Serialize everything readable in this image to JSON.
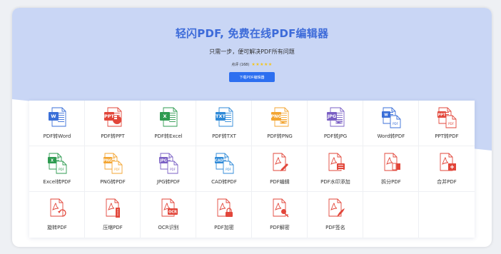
{
  "header": {
    "title": "轻闪PDF, 免费在线PDF编辑器",
    "subtitle": "只需一步，便可解决PDF所有问题",
    "rating_text": "点评 (168)",
    "stars": "★★★★★",
    "download_label": "下载PDF编辑器"
  },
  "colors": {
    "title": "#3d6bd9",
    "hero_background": "#c9d6f5",
    "button": "#2d6ff0",
    "stars": "#f5c518",
    "pdf_red": "#e2463a",
    "word_blue": "#3a6fd8",
    "excel_green": "#2e9b50",
    "png_orange": "#f3a532",
    "jpg_purple": "#7a5fc4",
    "txt_cad_blue": "#2f8ad8"
  },
  "tools": [
    {
      "label": "PDF转Word",
      "icon": "pdf-to-word-icon",
      "badge": "W"
    },
    {
      "label": "PDF转PPT",
      "icon": "pdf-to-ppt-icon",
      "badge": "PPT"
    },
    {
      "label": "PDF转Excel",
      "icon": "pdf-to-excel-icon",
      "badge": "X"
    },
    {
      "label": "PDF转TXT",
      "icon": "pdf-to-txt-icon",
      "badge": "TXT"
    },
    {
      "label": "PDF转PNG",
      "icon": "pdf-to-png-icon",
      "badge": "PNG"
    },
    {
      "label": "PDF转JPG",
      "icon": "pdf-to-jpg-icon",
      "badge": "JPG"
    },
    {
      "label": "Word转PDF",
      "icon": "word-to-pdf-icon",
      "badge": "W"
    },
    {
      "label": "PPT转PDF",
      "icon": "ppt-to-pdf-icon",
      "badge": "PPT"
    },
    {
      "label": "Excel转PDF",
      "icon": "excel-to-pdf-icon",
      "badge": "X"
    },
    {
      "label": "PNG转PDF",
      "icon": "png-to-pdf-icon",
      "badge": "PNG"
    },
    {
      "label": "JPG转PDF",
      "icon": "jpg-to-pdf-icon",
      "badge": "JPG"
    },
    {
      "label": "CAD转PDF",
      "icon": "cad-to-pdf-icon",
      "badge": "CAD"
    },
    {
      "label": "PDF编辑",
      "icon": "pdf-edit-icon"
    },
    {
      "label": "PDF水印添加",
      "icon": "pdf-watermark-icon"
    },
    {
      "label": "拆分PDF",
      "icon": "pdf-split-icon"
    },
    {
      "label": "合并PDF",
      "icon": "pdf-merge-icon"
    },
    {
      "label": "旋转PDF",
      "icon": "pdf-rotate-icon"
    },
    {
      "label": "压缩PDF",
      "icon": "pdf-compress-icon"
    },
    {
      "label": "OCR识别",
      "icon": "ocr-icon",
      "badge": "OCR"
    },
    {
      "label": "PDF加密",
      "icon": "pdf-encrypt-icon"
    },
    {
      "label": "PDF解密",
      "icon": "pdf-decrypt-icon"
    },
    {
      "label": "PDF签名",
      "icon": "pdf-sign-icon"
    }
  ]
}
